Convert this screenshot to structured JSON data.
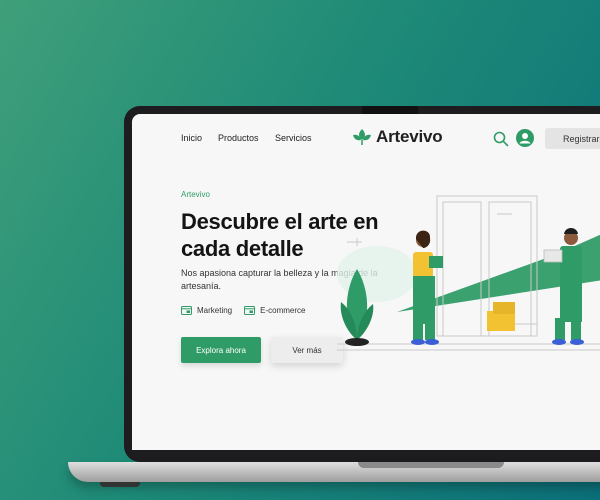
{
  "nav": {
    "links": [
      "Inicio",
      "Productos",
      "Servicios"
    ],
    "logo": "Artevivo",
    "register": "Registrarse"
  },
  "hero": {
    "eyebrow": "Artevivo",
    "headline": "Descubre el arte en cada detalle",
    "subtext": "Nos apasiona capturar la belleza y la magia de la artesanía.",
    "tags": [
      "Marketing",
      "E-commerce"
    ],
    "primary_button": "Explora ahora",
    "secondary_button": "Ver más"
  },
  "icons": [
    "leaf-logo-icon",
    "search-icon",
    "user-icon",
    "window-icon"
  ],
  "colors": {
    "brand_green": "#2f9c67",
    "background_start": "#3f9f7a",
    "background_end": "#0b6f79"
  }
}
